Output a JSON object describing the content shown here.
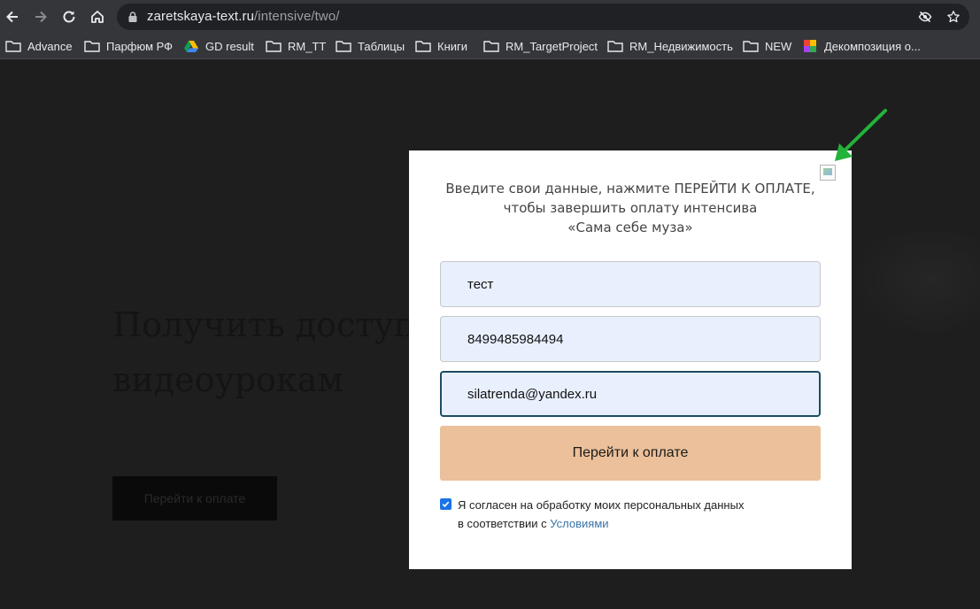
{
  "browser": {
    "url_host": "zaretskaya-text.ru",
    "url_path": "/intensive/two/",
    "bookmarks": [
      {
        "label": "Advance",
        "icon": "folder-icon"
      },
      {
        "label": "Парфюм РФ",
        "icon": "folder-icon"
      },
      {
        "label": "GD result",
        "icon": "google-drive-icon"
      },
      {
        "label": "RM_TT",
        "icon": "folder-icon"
      },
      {
        "label": "Таблицы",
        "icon": "folder-icon"
      },
      {
        "label": "Книги",
        "icon": "folder-icon"
      },
      {
        "label": "RM_TargetProject",
        "icon": "folder-icon"
      },
      {
        "label": "RM_Недвижимость",
        "icon": "folder-icon"
      },
      {
        "label": "NEW",
        "icon": "folder-icon"
      },
      {
        "label": "Декомпозиция о...",
        "icon": "colorful-app-icon"
      }
    ]
  },
  "page": {
    "heading_line1": "Получить доступ к",
    "heading_line2": "видеоурокам",
    "button_label": "Перейти к оплате"
  },
  "modal": {
    "title_line1": "Введите свои данные, нажмите ПЕРЕЙТИ К ОПЛАТЕ,",
    "title_line2": "чтобы завершить оплату интенсива",
    "title_line3": "«Сама себе муза»",
    "name_value": "тест",
    "phone_value": "8499485984494",
    "email_value": "silatrenda@yandex.ru",
    "submit_label": "Перейти к оплате",
    "consent_line1": "Я согласен на обработку моих персональных данных",
    "consent_line2_prefix": "в соответствии с ",
    "consent_link": "Условиями",
    "consent_checked": true
  },
  "colors": {
    "annotation_arrow": "#22b33a",
    "submit_button": "#ebc09a"
  }
}
